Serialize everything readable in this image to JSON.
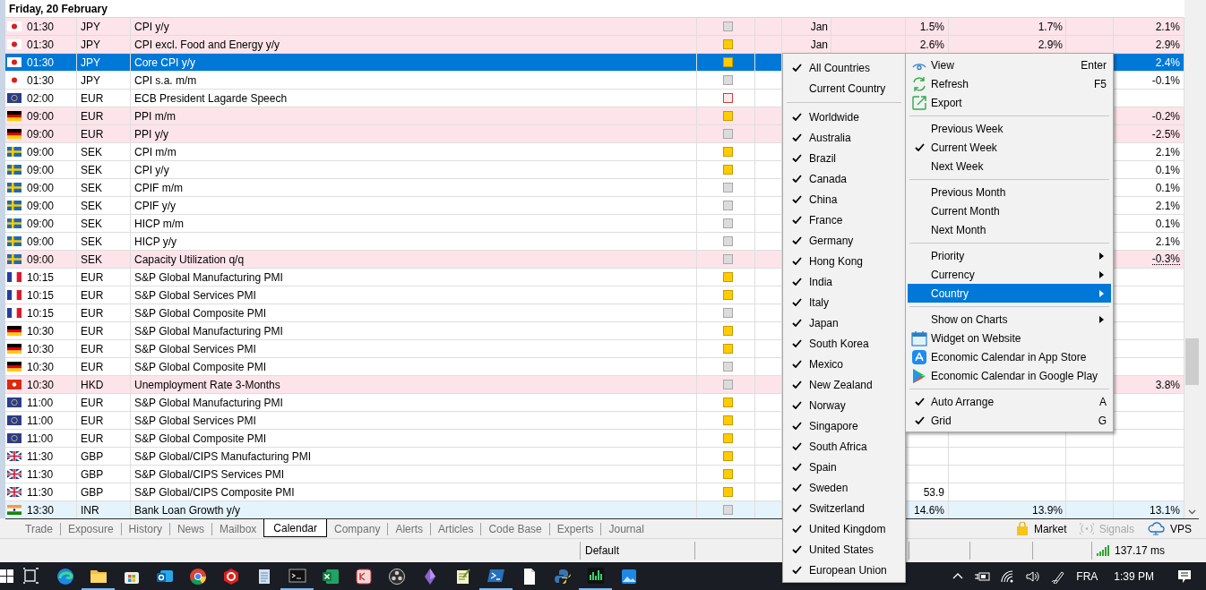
{
  "calendar": {
    "date_heading": "Friday, 20 February",
    "rows": [
      {
        "time": "01:30",
        "flag": {
          "kind": "JP"
        },
        "currency": "JPY",
        "event": "CPI y/y",
        "importance": {
          "kind": "low"
        },
        "period": "Jan",
        "actual": "1.5%",
        "forecast": "1.7%",
        "previous": "2.1%",
        "previous_revised": false,
        "color": "#fce4ea",
        "selected": false
      },
      {
        "time": "01:30",
        "flag": {
          "kind": "JP"
        },
        "currency": "JPY",
        "event": "CPI excl. Food and Energy y/y",
        "importance": {
          "kind": "medium"
        },
        "period": "Jan",
        "actual": "2.6%",
        "forecast": "2.9%",
        "previous": "2.9%",
        "previous_revised": false,
        "color": "#fce4ea",
        "selected": false
      },
      {
        "time": "01:30",
        "flag": {
          "kind": "JP"
        },
        "currency": "JPY",
        "event": "Core CPI y/y",
        "importance": {
          "kind": "medium"
        },
        "previous": "2.4%",
        "previous_revised": false,
        "selected": true
      },
      {
        "time": "01:30",
        "flag": {
          "kind": "JP"
        },
        "currency": "JPY",
        "event": "CPI s.a. m/m",
        "importance": {
          "kind": "low"
        },
        "previous": "-0.1%",
        "previous_revised": false,
        "color": "#ffffff",
        "selected": false
      },
      {
        "time": "02:00",
        "flag": {
          "kind": "EU"
        },
        "currency": "EUR",
        "event": "ECB President Lagarde Speech",
        "importance": {
          "kind": "high"
        },
        "color": "#ffffff",
        "selected": false
      },
      {
        "time": "09:00",
        "flag": {
          "kind": "DE"
        },
        "currency": "EUR",
        "event": "PPI m/m",
        "importance": {
          "kind": "medium"
        },
        "previous": "-0.2%",
        "previous_revised": false,
        "color": "#fce4ea",
        "selected": false
      },
      {
        "time": "09:00",
        "flag": {
          "kind": "DE"
        },
        "currency": "EUR",
        "event": "PPI y/y",
        "importance": {
          "kind": "low"
        },
        "previous": "-2.5%",
        "previous_revised": false,
        "color": "#fce4ea",
        "selected": false
      },
      {
        "time": "09:00",
        "flag": {
          "kind": "SE"
        },
        "currency": "SEK",
        "event": "CPI m/m",
        "importance": {
          "kind": "medium"
        },
        "previous": "2.1%",
        "previous_revised": false,
        "color": "#ffffff",
        "selected": false
      },
      {
        "time": "09:00",
        "flag": {
          "kind": "SE"
        },
        "currency": "SEK",
        "event": "CPI y/y",
        "importance": {
          "kind": "medium"
        },
        "previous": "0.1%",
        "previous_revised": false,
        "color": "#ffffff",
        "selected": false
      },
      {
        "time": "09:00",
        "flag": {
          "kind": "SE"
        },
        "currency": "SEK",
        "event": "CPIF m/m",
        "importance": {
          "kind": "low"
        },
        "previous": "0.1%",
        "previous_revised": false,
        "color": "#ffffff",
        "selected": false
      },
      {
        "time": "09:00",
        "flag": {
          "kind": "SE"
        },
        "currency": "SEK",
        "event": "CPIF y/y",
        "importance": {
          "kind": "low"
        },
        "previous": "2.1%",
        "previous_revised": false,
        "color": "#ffffff",
        "selected": false
      },
      {
        "time": "09:00",
        "flag": {
          "kind": "SE"
        },
        "currency": "SEK",
        "event": "HICP m/m",
        "importance": {
          "kind": "low"
        },
        "previous": "0.1%",
        "previous_revised": false,
        "color": "#ffffff",
        "selected": false
      },
      {
        "time": "09:00",
        "flag": {
          "kind": "SE"
        },
        "currency": "SEK",
        "event": "HICP y/y",
        "importance": {
          "kind": "low"
        },
        "previous": "2.1%",
        "previous_revised": false,
        "color": "#ffffff",
        "selected": false
      },
      {
        "time": "09:00",
        "flag": {
          "kind": "SE"
        },
        "currency": "SEK",
        "event": "Capacity Utilization q/q",
        "importance": {
          "kind": "low"
        },
        "previous": "-0.3%",
        "previous_revised": true,
        "color": "#fce4ea",
        "selected": false
      },
      {
        "time": "10:15",
        "flag": {
          "kind": "FR"
        },
        "currency": "EUR",
        "event": "S&P Global Manufacturing PMI",
        "importance": {
          "kind": "medium"
        },
        "color": "#ffffff",
        "selected": false
      },
      {
        "time": "10:15",
        "flag": {
          "kind": "FR"
        },
        "currency": "EUR",
        "event": "S&P Global Services PMI",
        "importance": {
          "kind": "medium"
        },
        "color": "#ffffff",
        "selected": false
      },
      {
        "time": "10:15",
        "flag": {
          "kind": "FR"
        },
        "currency": "EUR",
        "event": "S&P Global Composite PMI",
        "importance": {
          "kind": "low"
        },
        "color": "#ffffff",
        "selected": false
      },
      {
        "time": "10:30",
        "flag": {
          "kind": "DE"
        },
        "currency": "EUR",
        "event": "S&P Global Manufacturing PMI",
        "importance": {
          "kind": "medium"
        },
        "color": "#ffffff",
        "selected": false
      },
      {
        "time": "10:30",
        "flag": {
          "kind": "DE"
        },
        "currency": "EUR",
        "event": "S&P Global Services PMI",
        "importance": {
          "kind": "medium"
        },
        "color": "#ffffff",
        "selected": false
      },
      {
        "time": "10:30",
        "flag": {
          "kind": "DE"
        },
        "currency": "EUR",
        "event": "S&P Global Composite PMI",
        "importance": {
          "kind": "low"
        },
        "color": "#ffffff",
        "selected": false
      },
      {
        "time": "10:30",
        "flag": {
          "kind": "HK"
        },
        "currency": "HKD",
        "event": "Unemployment Rate 3-Months",
        "importance": {
          "kind": "low"
        },
        "previous": "3.8%",
        "previous_revised": false,
        "color": "#fce4ea",
        "selected": false
      },
      {
        "time": "11:00",
        "flag": {
          "kind": "EU"
        },
        "currency": "EUR",
        "event": "S&P Global Manufacturing PMI",
        "importance": {
          "kind": "medium"
        },
        "color": "#ffffff",
        "selected": false
      },
      {
        "time": "11:00",
        "flag": {
          "kind": "EU"
        },
        "currency": "EUR",
        "event": "S&P Global Services PMI",
        "importance": {
          "kind": "medium"
        },
        "color": "#ffffff",
        "selected": false
      },
      {
        "time": "11:00",
        "flag": {
          "kind": "EU"
        },
        "currency": "EUR",
        "event": "S&P Global Composite PMI",
        "importance": {
          "kind": "medium"
        },
        "color": "#ffffff",
        "selected": false
      },
      {
        "time": "11:30",
        "flag": {
          "kind": "GB"
        },
        "currency": "GBP",
        "event": "S&P Global/CIPS Manufacturing PMI",
        "importance": {
          "kind": "medium"
        },
        "color": "#ffffff",
        "selected": false
      },
      {
        "time": "11:30",
        "flag": {
          "kind": "GB"
        },
        "currency": "GBP",
        "event": "S&P Global/CIPS Services PMI",
        "importance": {
          "kind": "medium"
        },
        "color": "#ffffff",
        "selected": false
      },
      {
        "time": "11:30",
        "flag": {
          "kind": "GB"
        },
        "currency": "GBP",
        "event": "S&P Global/CIPS Composite PMI",
        "importance": {
          "kind": "medium"
        },
        "actual": "53.9",
        "color": "#ffffff",
        "selected": false
      },
      {
        "time": "13:30",
        "flag": {
          "kind": "IN"
        },
        "currency": "INR",
        "event": "Bank Loan Growth y/y",
        "importance": {
          "kind": "low"
        },
        "actual": "14.6%",
        "forecast": "13.9%",
        "previous": "13.1%",
        "previous_revised": false,
        "color": "#e5f3fb",
        "selected": false
      }
    ]
  },
  "bottom_tabs": [
    {
      "label": "Trade",
      "selected": false
    },
    {
      "label": "Exposure",
      "selected": false
    },
    {
      "label": "History",
      "selected": false
    },
    {
      "label": "News",
      "selected": false
    },
    {
      "label": "Mailbox",
      "selected": false
    },
    {
      "label": "Calendar",
      "selected": true
    },
    {
      "label": "Company",
      "selected": false
    },
    {
      "label": "Alerts",
      "selected": false
    },
    {
      "label": "Articles",
      "selected": false
    },
    {
      "label": "Code Base",
      "selected": false
    },
    {
      "label": "Experts",
      "selected": false
    },
    {
      "label": "Journal",
      "selected": false
    }
  ],
  "toolbar_links": [
    {
      "label": "Market",
      "disabled": false
    },
    {
      "label": "Signals",
      "disabled": true
    },
    {
      "label": "VPS",
      "disabled": false
    }
  ],
  "status_bar": {
    "profile": "Default",
    "ping": "137.17 ms"
  },
  "context_menu": {
    "items": [
      {
        "kind": "item",
        "label": "View",
        "shortcut": "Enter",
        "checked": false,
        "submenu": false,
        "selected": false
      },
      {
        "kind": "item",
        "label": "Refresh",
        "shortcut": "F5",
        "checked": false,
        "submenu": false,
        "selected": false
      },
      {
        "kind": "item",
        "label": "Export",
        "checked": false,
        "submenu": false,
        "selected": false
      },
      {
        "kind": "separator"
      },
      {
        "kind": "item",
        "label": "Previous Week",
        "checked": false,
        "submenu": false,
        "selected": false
      },
      {
        "kind": "item",
        "label": "Current Week",
        "checked": true,
        "submenu": false,
        "selected": false
      },
      {
        "kind": "item",
        "label": "Next Week",
        "checked": false,
        "submenu": false,
        "selected": false
      },
      {
        "kind": "separator"
      },
      {
        "kind": "item",
        "label": "Previous Month",
        "checked": false,
        "submenu": false,
        "selected": false
      },
      {
        "kind": "item",
        "label": "Current Month",
        "checked": false,
        "submenu": false,
        "selected": false
      },
      {
        "kind": "item",
        "label": "Next Month",
        "checked": false,
        "submenu": false,
        "selected": false
      },
      {
        "kind": "separator"
      },
      {
        "kind": "item",
        "label": "Priority",
        "checked": false,
        "submenu": true,
        "selected": false
      },
      {
        "kind": "item",
        "label": "Currency",
        "checked": false,
        "submenu": true,
        "selected": false
      },
      {
        "kind": "item",
        "label": "Country",
        "checked": false,
        "submenu": true,
        "selected": true
      },
      {
        "kind": "separator"
      },
      {
        "kind": "item",
        "label": "Show on Charts",
        "checked": false,
        "submenu": true,
        "selected": false
      },
      {
        "kind": "item",
        "label": "Widget on Website",
        "checked": false,
        "submenu": false,
        "selected": false
      },
      {
        "kind": "item",
        "label": "Economic Calendar in App Store",
        "checked": false,
        "submenu": false,
        "selected": false
      },
      {
        "kind": "item",
        "label": "Economic Calendar in Google Play",
        "checked": false,
        "submenu": false,
        "selected": false
      },
      {
        "kind": "separator"
      },
      {
        "kind": "item",
        "label": "Auto Arrange",
        "shortcut": "A",
        "checked": true,
        "submenu": false,
        "selected": false
      },
      {
        "kind": "item",
        "label": "Grid",
        "shortcut": "G",
        "checked": true,
        "submenu": false,
        "selected": false
      }
    ]
  },
  "country_submenu": {
    "items": [
      {
        "kind": "item",
        "label": "All Countries",
        "checked": true
      },
      {
        "kind": "item",
        "label": "Current Country",
        "checked": false
      },
      {
        "kind": "separator"
      },
      {
        "kind": "item",
        "label": "Worldwide",
        "checked": true
      },
      {
        "kind": "item",
        "label": "Australia",
        "checked": true
      },
      {
        "kind": "item",
        "label": "Brazil",
        "checked": true
      },
      {
        "kind": "item",
        "label": "Canada",
        "checked": true
      },
      {
        "kind": "item",
        "label": "China",
        "checked": true
      },
      {
        "kind": "item",
        "label": "France",
        "checked": true
      },
      {
        "kind": "item",
        "label": "Germany",
        "checked": true
      },
      {
        "kind": "item",
        "label": "Hong Kong",
        "checked": true
      },
      {
        "kind": "item",
        "label": "India",
        "checked": true
      },
      {
        "kind": "item",
        "label": "Italy",
        "checked": true
      },
      {
        "kind": "item",
        "label": "Japan",
        "checked": true
      },
      {
        "kind": "item",
        "label": "South Korea",
        "checked": true
      },
      {
        "kind": "item",
        "label": "Mexico",
        "checked": true
      },
      {
        "kind": "item",
        "label": "New Zealand",
        "checked": true
      },
      {
        "kind": "item",
        "label": "Norway",
        "checked": true
      },
      {
        "kind": "item",
        "label": "Singapore",
        "checked": true
      },
      {
        "kind": "item",
        "label": "South Africa",
        "checked": true
      },
      {
        "kind": "item",
        "label": "Spain",
        "checked": true
      },
      {
        "kind": "item",
        "label": "Sweden",
        "checked": true
      },
      {
        "kind": "item",
        "label": "Switzerland",
        "checked": true
      },
      {
        "kind": "item",
        "label": "United Kingdom",
        "checked": true
      },
      {
        "kind": "item",
        "label": "United States",
        "checked": true
      },
      {
        "kind": "item",
        "label": "European Union",
        "checked": true
      }
    ]
  },
  "taskbar": {
    "language": "FRA",
    "time": "1:39 PM"
  }
}
